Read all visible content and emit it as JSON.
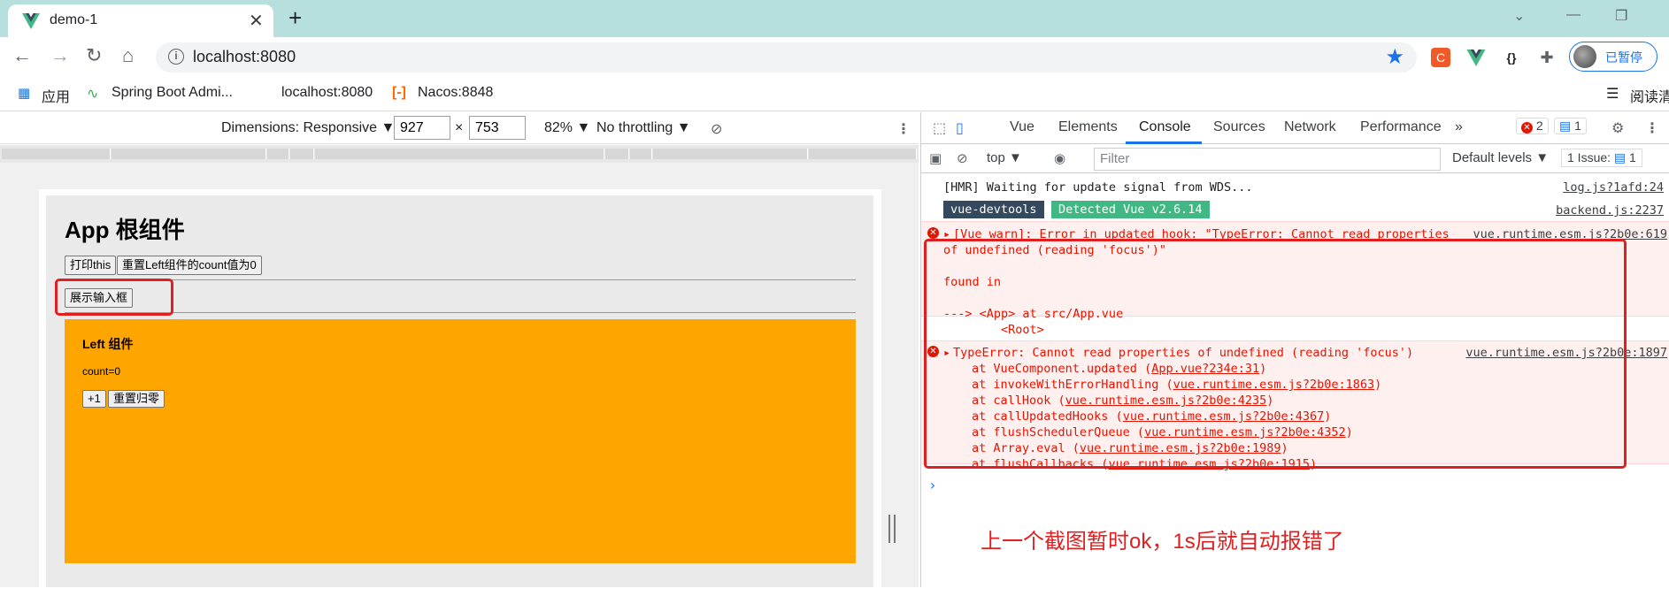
{
  "browser": {
    "tab_title": "demo-1",
    "url": "localhost:8080",
    "profile_label": "已暂停"
  },
  "bookmarks": [
    {
      "label": "应用"
    },
    {
      "label": "Spring Boot Admi..."
    },
    {
      "label": "localhost:8080"
    },
    {
      "label": "Nacos:8848"
    },
    {
      "label": "阅读清"
    }
  ],
  "device_toolbar": {
    "dimensions_label": "Dimensions: Responsive ▼",
    "width": "927",
    "height": "753",
    "times": "×",
    "zoom": "82% ▼",
    "throttle": "No throttling ▼"
  },
  "app": {
    "title": "App 根组件",
    "print_this_button": "打印this",
    "reset_left_count_button": "重置Left组件的count值为0",
    "show_input_button": "展示输入框",
    "left_component": {
      "title": "Left 组件",
      "count_text": "count=0",
      "plus_one_button": "+1",
      "reset_button": "重置归零"
    }
  },
  "devtools": {
    "tabs": [
      "Vue",
      "Elements",
      "Console",
      "Sources",
      "Network",
      "Performance"
    ],
    "selected_tab": "Console",
    "error_count": "2",
    "message_count": "1",
    "context": "top ▼",
    "filter_placeholder": "Filter",
    "levels": "Default levels ▼",
    "issues_label": "1 Issue:",
    "issues_count": "1",
    "console": {
      "hmr_line": "[HMR] Waiting for update signal from WDS...",
      "hmr_source": "log.js?1afd:24",
      "devtools_badge": "vue-devtools",
      "detected_badge": "Detected Vue v2.6.14",
      "devtools_source": "backend.js:2237",
      "warn_line1": "[Vue warn]: Error in updated hook: \"TypeError: Cannot read properties",
      "warn_line2": "of undefined (reading 'focus')\"",
      "warn_source": "vue.runtime.esm.js?2b0e:619",
      "found_in": "found in",
      "app_line": "---> <App> at src/App.vue",
      "root_line": "<Root>",
      "type_error": "TypeError: Cannot read properties of undefined (reading 'focus')",
      "type_error_source": "vue.runtime.esm.js?2b0e:1897",
      "stack": [
        {
          "fn": "at VueComponent.updated (",
          "loc": "App.vue?234e:31",
          "end": ")"
        },
        {
          "fn": "at invokeWithErrorHandling (",
          "loc": "vue.runtime.esm.js?2b0e:1863",
          "end": ")"
        },
        {
          "fn": "at callHook (",
          "loc": "vue.runtime.esm.js?2b0e:4235",
          "end": ")"
        },
        {
          "fn": "at callUpdatedHooks (",
          "loc": "vue.runtime.esm.js?2b0e:4367",
          "end": ")"
        },
        {
          "fn": "at flushSchedulerQueue (",
          "loc": "vue.runtime.esm.js?2b0e:4352",
          "end": ")"
        },
        {
          "fn": "at Array.eval (",
          "loc": "vue.runtime.esm.js?2b0e:1989",
          "end": ")"
        },
        {
          "fn": "at flushCallbacks (",
          "loc": "vue.runtime.esm.js?2b0e:1915",
          "end": ")"
        }
      ],
      "prompt": "›"
    }
  },
  "annotation": "上一个截图暂时ok，1s后就自动报错了",
  "colors": {
    "tabstrip": "#b6dfde",
    "left_component_bg": "#ffa500",
    "highlight_red": "#e02020",
    "error_text": "#e51400",
    "accent_blue": "#1a73e8"
  }
}
